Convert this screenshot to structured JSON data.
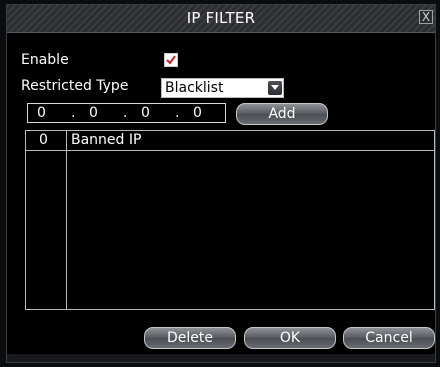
{
  "dialog": {
    "title": "IP FILTER",
    "close_label": "X"
  },
  "form": {
    "enable_label": "Enable",
    "enable_checked": true,
    "restricted_type_label": "Restricted Type",
    "restricted_type_value": "Blacklist"
  },
  "ip_input": {
    "octets": [
      "0",
      "0",
      "0",
      "0"
    ],
    "separators": [
      ".",
      ".",
      "."
    ]
  },
  "buttons": {
    "add": "Add",
    "delete": "Delete",
    "ok": "OK",
    "cancel": "Cancel"
  },
  "table": {
    "headers": [
      "0",
      "Banned IP"
    ],
    "rows": []
  },
  "icons": {
    "checkbox": "check-icon",
    "dropdown": "chevron-down-icon",
    "close": "close-icon"
  },
  "colors": {
    "background": "#000000",
    "check": "#d01f1f",
    "text": "#ffffff"
  }
}
